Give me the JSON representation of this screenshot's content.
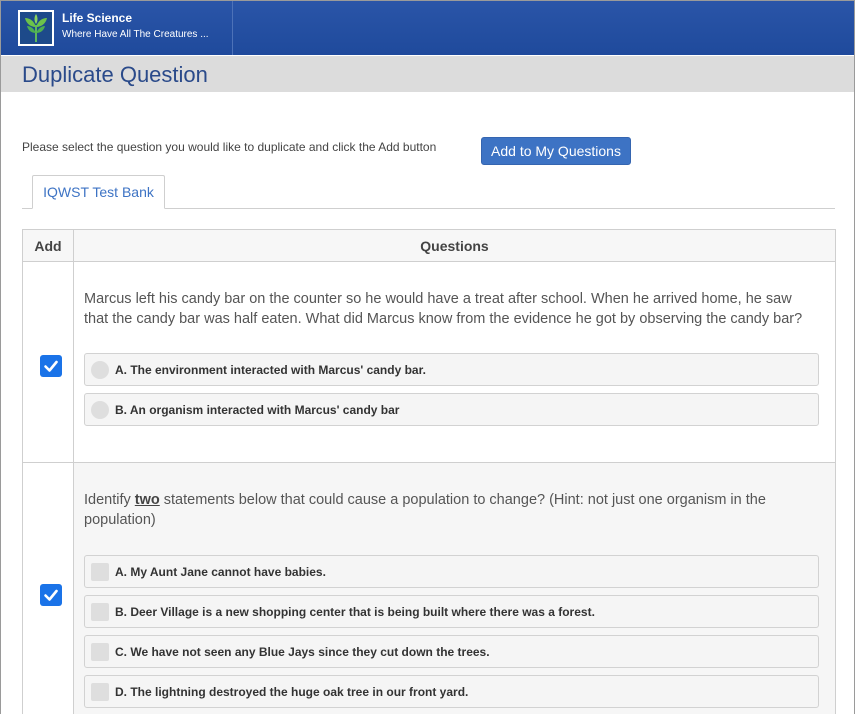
{
  "header": {
    "app_title": "Life Science",
    "app_subtitle": "Where Have All The Creatures ...",
    "logo_icon": "sprout-icon"
  },
  "page": {
    "title": "Duplicate Question",
    "instructions": "Please select the question you would like to duplicate and click the Add button",
    "add_button_label": "Add to My Questions"
  },
  "tabs": [
    {
      "label": "IQWST Test Bank",
      "active": true
    }
  ],
  "table": {
    "col_add": "Add",
    "col_questions": "Questions"
  },
  "questions": [
    {
      "checked": true,
      "text": "Marcus left his candy bar on the counter so he would have a treat after school. When he arrived home, he saw that the candy bar was half eaten. What did Marcus know from the evidence he got by observing the candy bar?",
      "answer_type": "radio",
      "answers": [
        "A. The environment interacted with Marcus' candy bar.",
        "B. An organism interacted with Marcus' candy bar"
      ]
    },
    {
      "checked": true,
      "text_before": "Identify ",
      "text_emphasis": "two",
      "text_after": " statements below that could cause a population to change? (Hint: not just one organism in the population)",
      "answer_type": "checkbox",
      "answers": [
        "A. My Aunt Jane cannot have babies.",
        "B. Deer Village is a new shopping center that is being built where there was a forest.",
        "C. We have not seen any Blue Jays since they cut down the trees.",
        "D. The lightning destroyed the huge oak tree in our front yard."
      ]
    }
  ],
  "colors": {
    "header_blue": "#1f4a9c",
    "title_blue": "#2a4a8a",
    "button_blue": "#3d73c4",
    "checkbox_blue": "#1a73e8"
  }
}
